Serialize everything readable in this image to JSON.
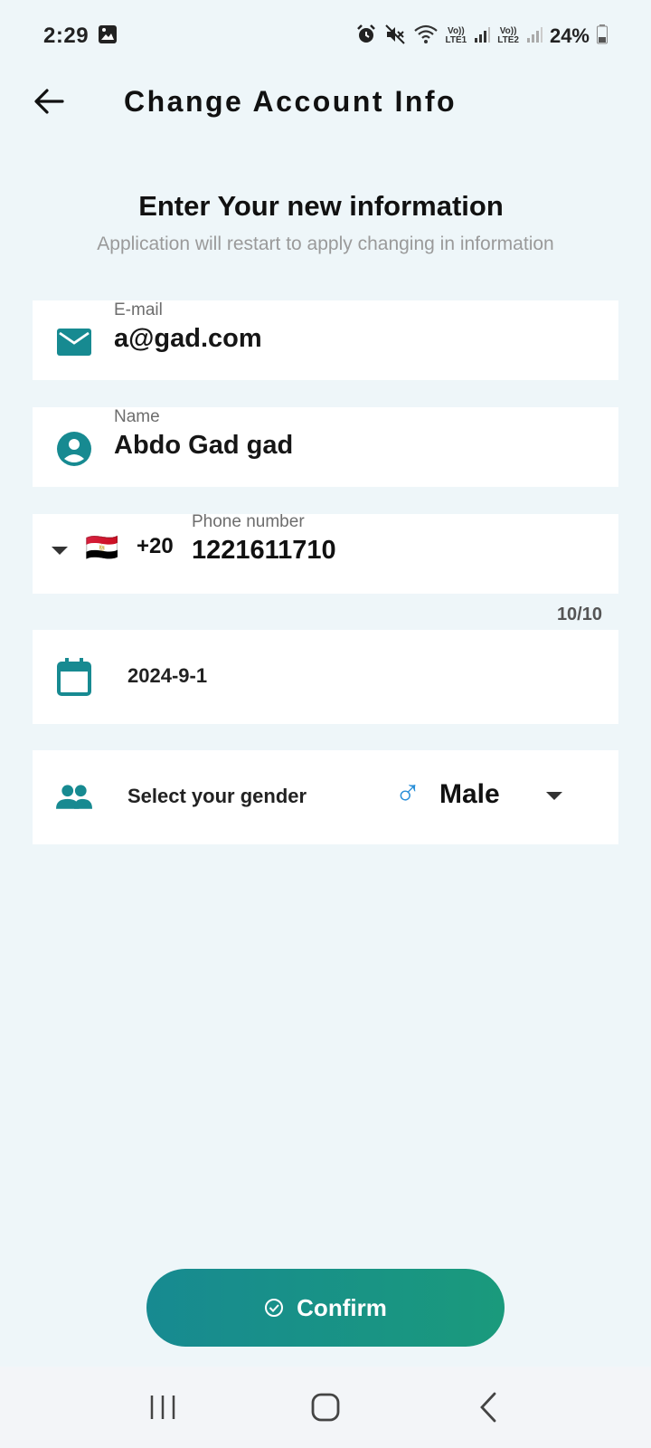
{
  "status_bar": {
    "time": "2:29",
    "sim1_label_top": "Vo))",
    "sim1_label_bottom": "LTE1",
    "sim2_label_top": "Vo))",
    "sim2_label_bottom": "LTE2",
    "battery": "24%"
  },
  "header": {
    "title": "Change Account Info"
  },
  "intro": {
    "title": "Enter Your new information",
    "subtitle": "Application will restart to apply changing in information"
  },
  "form": {
    "email": {
      "label": "E-mail",
      "value": "a@gad.com"
    },
    "name": {
      "label": "Name",
      "value": "Abdo Gad gad"
    },
    "phone": {
      "label": "Phone number",
      "country_code": "+20",
      "flag": "🇪🇬",
      "value": "1221611710",
      "counter": "10/10"
    },
    "date": {
      "value": "2024-9-1"
    },
    "gender": {
      "label": "Select your gender",
      "value": "Male",
      "symbol": "♂"
    }
  },
  "confirm_button": {
    "label": "Confirm"
  },
  "colors": {
    "accent": "#178a91",
    "accent_end": "#1a9a7c",
    "background": "#eef6f9",
    "male_blue": "#2a8fd8"
  }
}
